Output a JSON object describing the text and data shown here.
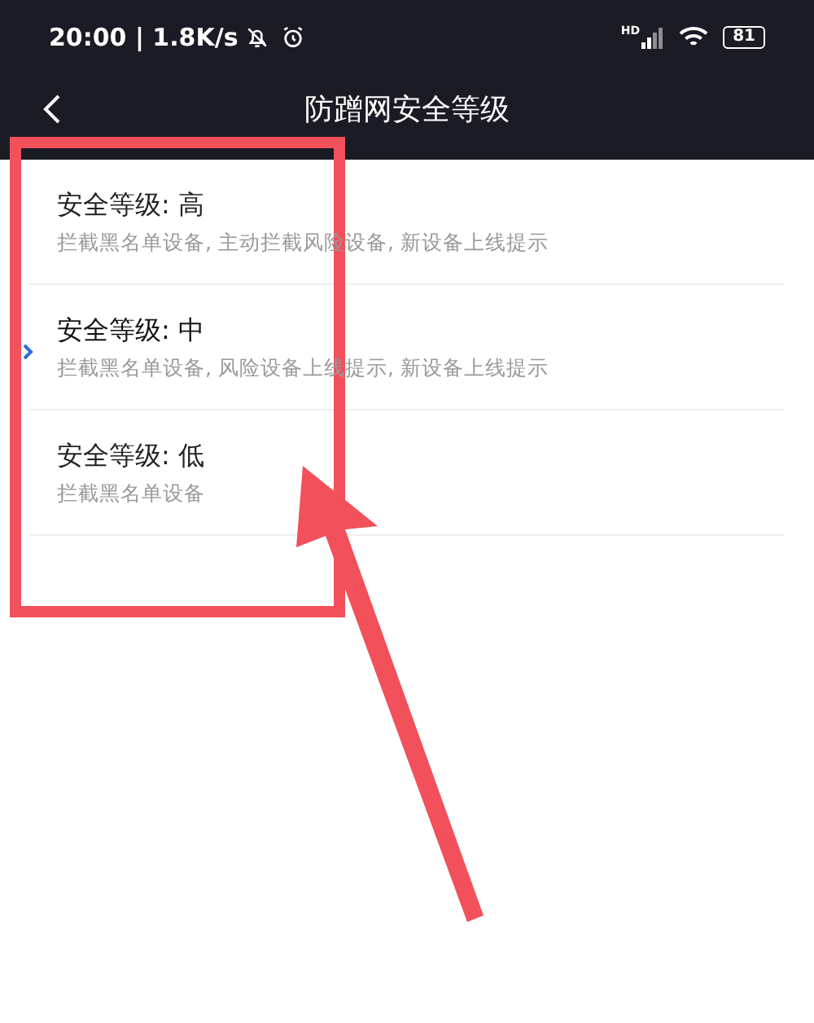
{
  "status_bar": {
    "time": "20:00 | 1.8K/s",
    "signal_label": "HD",
    "battery": "81"
  },
  "nav": {
    "title": "防蹭网安全等级"
  },
  "levels": [
    {
      "title": "安全等级: 高",
      "description": "拦截黑名单设备, 主动拦截风险设备, 新设备上线提示",
      "selected": false
    },
    {
      "title": "安全等级: 中",
      "description": "拦截黑名单设备, 风险设备上线提示, 新设备上线提示",
      "selected": true
    },
    {
      "title": "安全等级: 低",
      "description": "拦截黑名单设备",
      "selected": false
    }
  ]
}
